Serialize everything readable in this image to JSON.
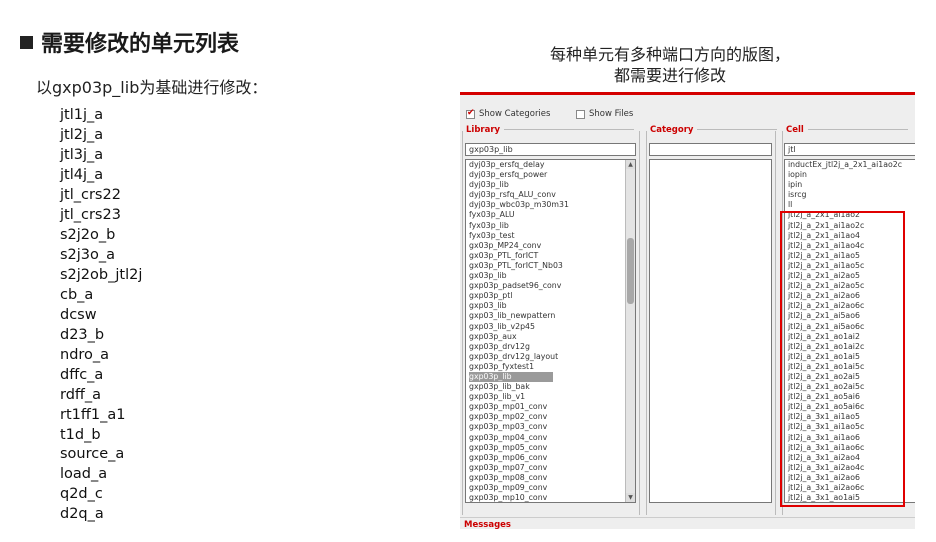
{
  "slide": {
    "title": "需要修改的单元列表",
    "subtitle": "以gxp03p_lib为基础进行修改：",
    "cells": [
      "jtl1j_a",
      "jtl2j_a",
      "jtl3j_a",
      "jtl4j_a",
      "jtl_crs22",
      "jtl_crs23",
      "s2j2o_b",
      "s2j3o_a",
      "s2j2ob_jtl2j",
      "cb_a",
      "dcsw",
      "d23_b",
      "ndro_a",
      "dffc_a",
      "rdff_a",
      "rt1ff1_a1",
      "t1d_b",
      "source_a",
      "load_a",
      "q2d_c",
      "d2q_a"
    ],
    "caption_line1": "每种单元有多种端口方向的版图，",
    "caption_line2": "都需要进行修改"
  },
  "window": {
    "accent_color": "#d40000",
    "show_categories_label": "Show Categories",
    "show_categories_checked": true,
    "show_files_label": "Show Files",
    "show_files_checked": false,
    "library_header": "Library",
    "category_header": "Category",
    "cell_header": "Cell",
    "library_filter": "gxp03p_lib",
    "category_filter": "",
    "cell_filter": "jtl",
    "libraries": [
      "dyj03p_ersfq_delay",
      "dyj03p_ersfq_power",
      "dyj03p_lib",
      "dyj03p_rsfq_ALU_conv",
      "dyj03p_wbc03p_m30m31",
      "fyx03p_ALU",
      "fyx03p_lib",
      "fyx03p_test",
      "gx03p_MP24_conv",
      "gx03p_PTL_forICT",
      "gx03p_PTL_forICT_Nb03",
      "gx03p_lib",
      "gxp03p_padset96_conv",
      "gxp03p_ptl",
      "gxp03_lib",
      "gxp03_lib_newpattern",
      "gxp03_lib_v2p45",
      "gxp03p_aux",
      "gxp03p_drv12g",
      "gxp03p_drv12g_layout",
      "gxp03p_fyxtest1",
      "gxp03p_lib",
      "gxp03p_lib_bak",
      "gxp03p_lib_v1",
      "gxp03p_mp01_conv",
      "gxp03p_mp02_conv",
      "gxp03p_mp03_conv",
      "gxp03p_mp04_conv",
      "gxp03p_mp05_conv",
      "gxp03p_mp06_conv",
      "gxp03p_mp07_conv",
      "gxp03p_mp08_conv",
      "gxp03p_mp09_conv",
      "gxp03p_mp10_conv"
    ],
    "selected_library_index": 21,
    "cells_other": [
      "inductEx_jtl2j_a_2x1_ai1ao2c",
      "iopin",
      "ipin",
      "isrcg",
      "ll"
    ],
    "cells_jtl2j": [
      "jtl2j_a_2x1_ai1ao2",
      "jtl2j_a_2x1_ai1ao2c",
      "jtl2j_a_2x1_ai1ao4",
      "jtl2j_a_2x1_ai1ao4c",
      "jtl2j_a_2x1_ai1ao5",
      "jtl2j_a_2x1_ai1ao5c",
      "jtl2j_a_2x1_ai2ao5",
      "jtl2j_a_2x1_ai2ao5c",
      "jtl2j_a_2x1_ai2ao6",
      "jtl2j_a_2x1_ai2ao6c",
      "jtl2j_a_2x1_ai5ao6",
      "jtl2j_a_2x1_ai5ao6c",
      "jtl2j_a_2x1_ao1ai2",
      "jtl2j_a_2x1_ao1ai2c",
      "jtl2j_a_2x1_ao1ai5",
      "jtl2j_a_2x1_ao1ai5c",
      "jtl2j_a_2x1_ao2ai5",
      "jtl2j_a_2x1_ao2ai5c",
      "jtl2j_a_2x1_ao5ai6",
      "jtl2j_a_2x1_ao5ai6c",
      "jtl2j_a_3x1_ai1ao5",
      "jtl2j_a_3x1_ai1ao5c",
      "jtl2j_a_3x1_ai1ao6",
      "jtl2j_a_3x1_ai1ao6c",
      "jtl2j_a_3x1_ai2ao4",
      "jtl2j_a_3x1_ai2ao4c",
      "jtl2j_a_3x1_ai2ao6",
      "jtl2j_a_3x1_ai2ao6c",
      "jtl2j_a_3x1_ao1ai5"
    ],
    "messages_label": "Messages"
  }
}
